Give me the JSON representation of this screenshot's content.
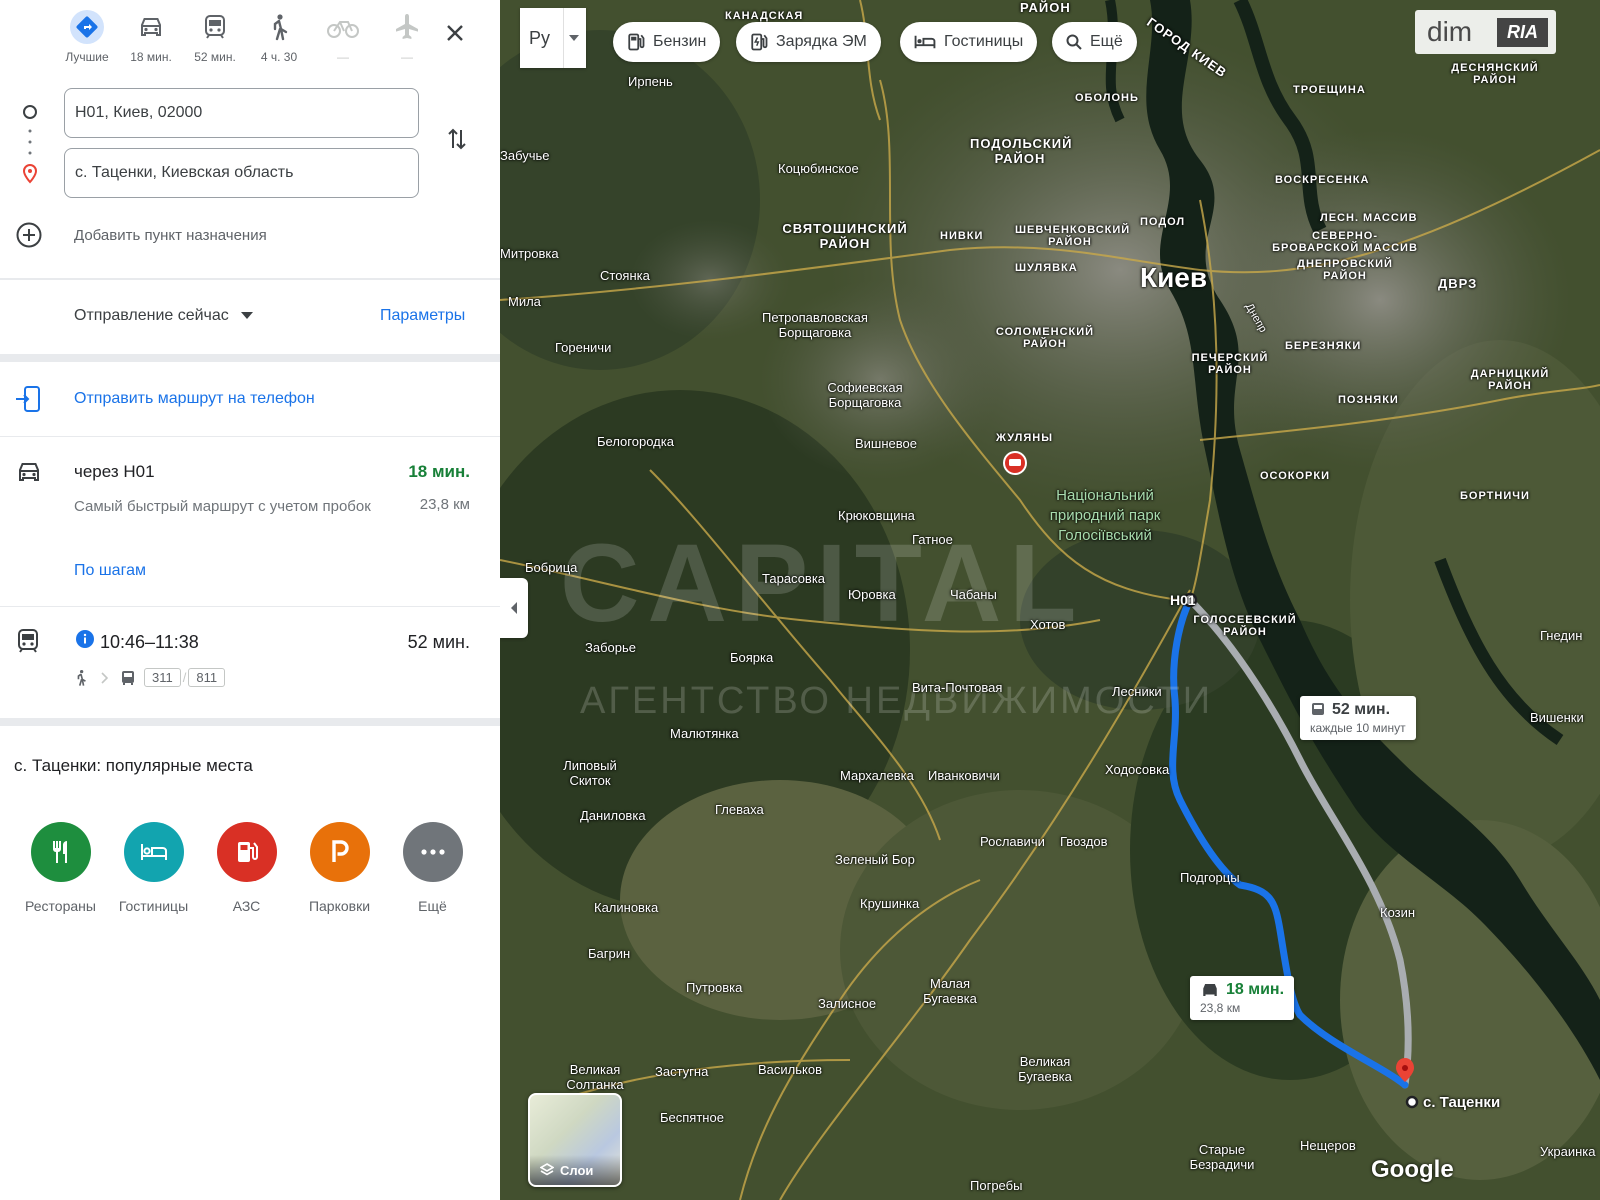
{
  "modes": [
    {
      "id": "best",
      "label": "Лучшие",
      "icon": "diamond-directions-icon",
      "active": true
    },
    {
      "id": "car",
      "label": "18 мин.",
      "icon": "car-icon"
    },
    {
      "id": "transit",
      "label": "52 мин.",
      "icon": "train-icon"
    },
    {
      "id": "walk",
      "label": "4 ч. 30",
      "icon": "walk-icon"
    },
    {
      "id": "bike",
      "label": "—",
      "icon": "bike-icon",
      "disabled": true
    },
    {
      "id": "flight",
      "label": "—",
      "icon": "airplane-icon",
      "disabled": true
    }
  ],
  "origin": "Н01, Киев, 02000",
  "destination": "с. Таценки, Киевская область",
  "add_destination": "Добавить пункт назначения",
  "depart": "Отправление сейчас",
  "params": "Параметры",
  "send_phone": "Отправить маршрут на телефон",
  "car_route": {
    "title": "через Н01",
    "time": "18 мин.",
    "desc": "Самый быстрый маршрут с учетом пробок",
    "dist": "23,8 км",
    "steps": "По шагам"
  },
  "transit_route": {
    "title": "10:46–11:38",
    "time": "52 мин.",
    "buses": [
      "311",
      "811"
    ]
  },
  "popular": {
    "title": "с. Таценки: популярные места",
    "categories": [
      {
        "label": "Рестораны",
        "color": "#1e8e3e",
        "icon": "restaurant-icon"
      },
      {
        "label": "Гостиницы",
        "color": "#12a4af",
        "icon": "hotel-icon"
      },
      {
        "label": "АЗС",
        "color": "#d93025",
        "icon": "gas-station-icon"
      },
      {
        "label": "Парковки",
        "color": "#e8710a",
        "icon": "parking-icon"
      },
      {
        "label": "Ещё",
        "color": "#70757a",
        "icon": "more-icon"
      }
    ]
  },
  "map": {
    "lang": "Ру",
    "chips": [
      "Бензин",
      "Зарядка ЭМ",
      "Гостиницы",
      "Ещё"
    ],
    "logo_dim": "dim",
    "logo_ria": "RIA",
    "car_box": {
      "time": "18 мин.",
      "dist": "23,8 км"
    },
    "transit_box": {
      "time": "52 мин.",
      "sub": "каждые 10 минут"
    },
    "origin_label": "Н01",
    "dest_label": "с. Таценки",
    "layers": "Слои",
    "google": "Google",
    "watermark": "CAPITAL",
    "watermark_sub": "АГЕНТСТВО НЕДВИЖИМОСТИ",
    "labels": {
      "kyiv": "Киев",
      "park": "Національний природний парк Голосіївський",
      "l1": "РАЙОН",
      "l2": "КАНАДСКАЯ",
      "l3": "ОБОЛОНЬ",
      "l4": "ПОДОЛЬСКИЙ РАЙОН",
      "l5": "Коцюбинское",
      "l6": "Ирпень",
      "l7": "СВЯТОШИНСКИЙ РАЙОН",
      "l8": "НИВКИ",
      "l9": "ШЕВЧЕНКОВСКИЙ РАЙОН",
      "l10": "ПОДОЛ",
      "l11": "ШУЛЯВКА",
      "l12": "Стоянка",
      "l13": "Мила",
      "l14": "Петропавловская Борщаговка",
      "l15": "СОЛОМЕНСКИЙ РАЙОН",
      "l16": "Гореничи",
      "l17": "Софиевская Борщаговка",
      "l18": "ПЕЧЕРСКИЙ РАЙОН",
      "l19": "Белогородка",
      "l20": "Вишневое",
      "l21": "ЖУЛЯНЫ",
      "l22": "Крюковщина",
      "l23": "Гатное",
      "l24": "Тарасовка",
      "l25": "Юровка",
      "l26": "Чабаны",
      "l27": "Хотов",
      "l28": "Бобрица",
      "l29": "Заборье",
      "l30": "Боярка",
      "l31": "Вита-Почтовая",
      "l32": "Лесники",
      "l33": "ГОЛОСЕЕВСКИЙ РАЙОН",
      "l34": "Малютянка",
      "l35": "Липовый Скиток",
      "l36": "Мархалевка",
      "l37": "Иванковичи",
      "l38": "Ходосовка",
      "l39": "Даниловка",
      "l40": "Глеваха",
      "l41": "Рославичи",
      "l42": "Гвоздов",
      "l43": "Зеленый Бор",
      "l44": "Подгорцы",
      "l45": "Калиновка",
      "l46": "Крушинка",
      "l47": "Козин",
      "l48": "Багрин",
      "l49": "Путровка",
      "l50": "Малая Бугаевка",
      "l51": "Залисное",
      "l52": "Великая Бугаевка",
      "l53": "Великая Солтанка",
      "l54": "Застугна",
      "l55": "Васильков",
      "l56": "Беспятное",
      "l57": "Старые Безрадичи",
      "l58": "Нещеров",
      "l59": "Погребы",
      "l60": "ТРОЕЩИНА",
      "l61": "ВОСКРЕСЕНКА",
      "l62": "ЛЕСН. МАССИВ",
      "l63": "СЕВЕРНО-БРОВАРСКОЙ МАССИВ",
      "l64": "ДНЕПРОВСКИЙ РАЙОН",
      "l65": "ДВРЗ",
      "l66": "БЕРЕЗНЯКИ",
      "l67": "ПОЗНЯКИ",
      "l68": "ДАРНИЦКИЙ РАЙОН",
      "l69": "ОСОКОРКИ",
      "l70": "БОРТНИЧИ",
      "l71": "Гнедин",
      "l72": "Вишенки",
      "l73": "ДЕСНЯНСКИЙ РАЙОН",
      "l74": "Забучье",
      "l75": "Митровка",
      "l76": "Украинка",
      "l77": "ГОРОД КИЕВ",
      "l78": "Днепр"
    }
  }
}
